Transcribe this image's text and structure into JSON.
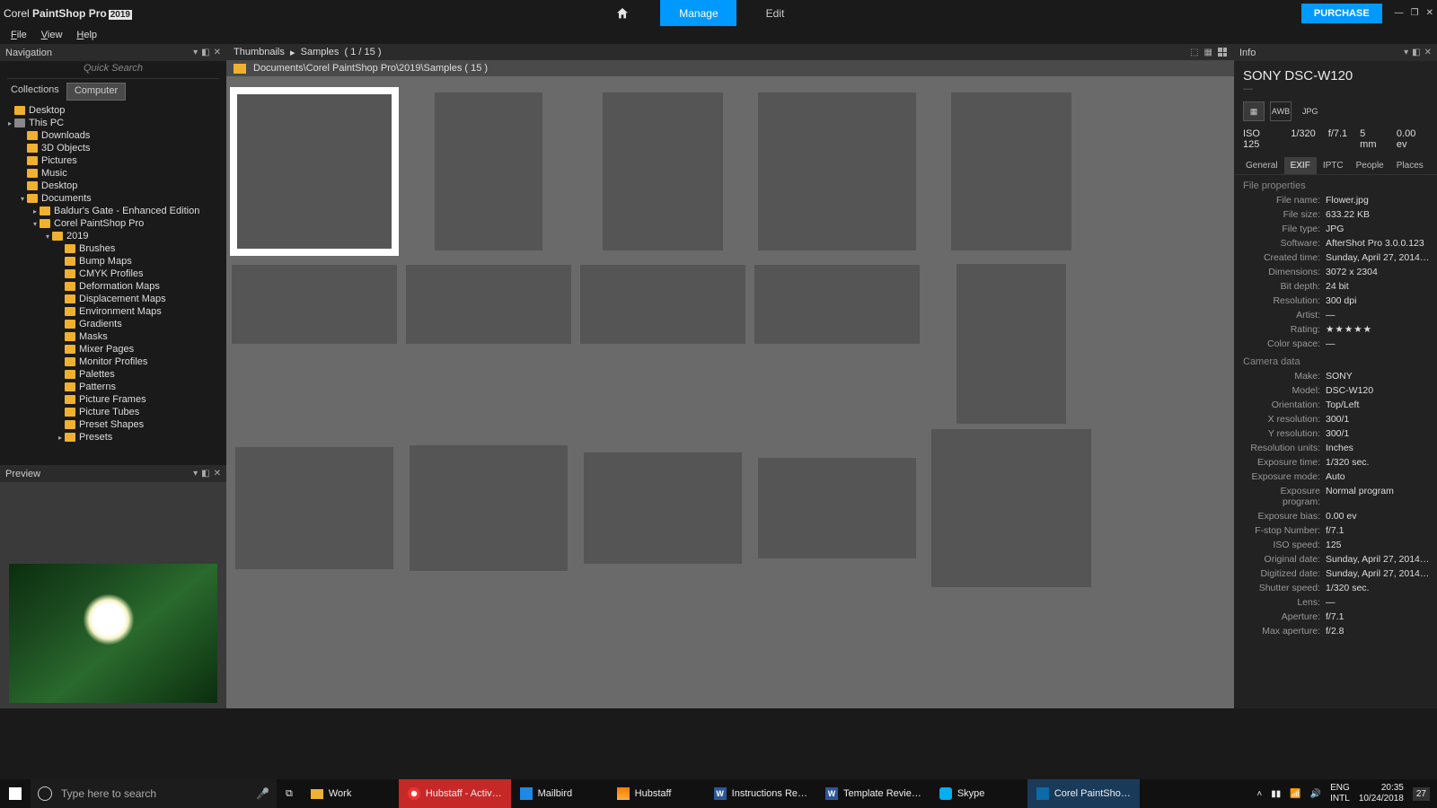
{
  "app": {
    "brand": "Corel",
    "name": "PaintShop Pro",
    "version": "2019"
  },
  "topNav": {
    "home": "Home",
    "manage": "Manage",
    "edit": "Edit",
    "purchase": "PURCHASE"
  },
  "menus": [
    "File",
    "View",
    "Help"
  ],
  "nav": {
    "title": "Navigation",
    "searchPlaceholder": "Quick Search",
    "tabs": {
      "collections": "Collections",
      "computer": "Computer"
    },
    "tree": [
      {
        "lvl": 0,
        "caret": "",
        "icon": "fold",
        "label": "Desktop"
      },
      {
        "lvl": 0,
        "caret": "▸",
        "icon": "drv",
        "label": "This PC"
      },
      {
        "lvl": 1,
        "caret": "",
        "icon": "fold",
        "label": "Downloads"
      },
      {
        "lvl": 1,
        "caret": "",
        "icon": "fold",
        "label": "3D Objects"
      },
      {
        "lvl": 1,
        "caret": "",
        "icon": "fold",
        "label": "Pictures"
      },
      {
        "lvl": 1,
        "caret": "",
        "icon": "fold",
        "label": "Music"
      },
      {
        "lvl": 1,
        "caret": "",
        "icon": "fold",
        "label": "Desktop"
      },
      {
        "lvl": 1,
        "caret": "▾",
        "icon": "fold",
        "label": "Documents"
      },
      {
        "lvl": 2,
        "caret": "▸",
        "icon": "fold",
        "label": "Baldur's Gate - Enhanced Edition"
      },
      {
        "lvl": 2,
        "caret": "▾",
        "icon": "fold",
        "label": "Corel PaintShop Pro"
      },
      {
        "lvl": 3,
        "caret": "▾",
        "icon": "fold",
        "label": "2019"
      },
      {
        "lvl": 4,
        "caret": "",
        "icon": "fold",
        "label": "Brushes"
      },
      {
        "lvl": 4,
        "caret": "",
        "icon": "fold",
        "label": "Bump Maps"
      },
      {
        "lvl": 4,
        "caret": "",
        "icon": "fold",
        "label": "CMYK Profiles"
      },
      {
        "lvl": 4,
        "caret": "",
        "icon": "fold",
        "label": "Deformation Maps"
      },
      {
        "lvl": 4,
        "caret": "",
        "icon": "fold",
        "label": "Displacement Maps"
      },
      {
        "lvl": 4,
        "caret": "",
        "icon": "fold",
        "label": "Environment Maps"
      },
      {
        "lvl": 4,
        "caret": "",
        "icon": "fold",
        "label": "Gradients"
      },
      {
        "lvl": 4,
        "caret": "",
        "icon": "fold",
        "label": "Masks"
      },
      {
        "lvl": 4,
        "caret": "",
        "icon": "fold",
        "label": "Mixer Pages"
      },
      {
        "lvl": 4,
        "caret": "",
        "icon": "fold",
        "label": "Monitor Profiles"
      },
      {
        "lvl": 4,
        "caret": "",
        "icon": "fold",
        "label": "Palettes"
      },
      {
        "lvl": 4,
        "caret": "",
        "icon": "fold",
        "label": "Patterns"
      },
      {
        "lvl": 4,
        "caret": "",
        "icon": "fold",
        "label": "Picture Frames"
      },
      {
        "lvl": 4,
        "caret": "",
        "icon": "fold",
        "label": "Picture Tubes"
      },
      {
        "lvl": 4,
        "caret": "",
        "icon": "fold",
        "label": "Preset Shapes"
      },
      {
        "lvl": 4,
        "caret": "▸",
        "icon": "fold",
        "label": "Presets"
      }
    ]
  },
  "preview": {
    "title": "Preview"
  },
  "crumbs": {
    "a": "Thumbnails",
    "b": "Samples",
    "c": "( 1 / 15 )"
  },
  "path": "Documents\\Corel PaintShop Pro\\2019\\Samples ( 15 )",
  "info": {
    "title": "Info",
    "camera": "SONY DSC-W120",
    "jpgBadge": "JPG",
    "exif": {
      "iso": "ISO 125",
      "shutter": "1/320",
      "f": "f/7.1",
      "focal": "5 mm",
      "ev": "0.00 ev"
    },
    "tabs": [
      "General",
      "EXIF",
      "IPTC",
      "People",
      "Places"
    ],
    "fileSection": "File properties",
    "file": [
      {
        "k": "File name:",
        "v": "Flower.jpg"
      },
      {
        "k": "File size:",
        "v": "633.22 KB"
      },
      {
        "k": "File type:",
        "v": "JPG"
      },
      {
        "k": "Software:",
        "v": "AfterShot Pro 3.0.0.123"
      },
      {
        "k": "Created time:",
        "v": "Sunday, April 27, 2014…"
      },
      {
        "k": "Dimensions:",
        "v": "3072 x 2304"
      },
      {
        "k": "Bit depth:",
        "v": "24 bit"
      },
      {
        "k": "Resolution:",
        "v": "300 dpi"
      },
      {
        "k": "Artist:",
        "v": "—"
      },
      {
        "k": "Rating:",
        "v": "★★★★★"
      },
      {
        "k": "Color space:",
        "v": "—"
      }
    ],
    "camSection": "Camera data",
    "cam": [
      {
        "k": "Make:",
        "v": "SONY"
      },
      {
        "k": "Model:",
        "v": "DSC-W120"
      },
      {
        "k": "Orientation:",
        "v": "Top/Left"
      },
      {
        "k": "X resolution:",
        "v": "300/1"
      },
      {
        "k": "Y resolution:",
        "v": "300/1"
      },
      {
        "k": "Resolution units:",
        "v": "Inches"
      },
      {
        "k": "Exposure time:",
        "v": "1/320 sec."
      },
      {
        "k": "Exposure mode:",
        "v": "Auto"
      },
      {
        "k": "Exposure program:",
        "v": "Normal program"
      },
      {
        "k": "Exposure bias:",
        "v": "0.00 ev"
      },
      {
        "k": "F-stop Number:",
        "v": "f/7.1"
      },
      {
        "k": "ISO speed:",
        "v": "125"
      },
      {
        "k": "Original date:",
        "v": "Sunday, April 27, 2014…"
      },
      {
        "k": "Digitized date:",
        "v": "Sunday, April 27, 2014…"
      },
      {
        "k": "Shutter speed:",
        "v": "1/320 sec."
      },
      {
        "k": "Lens:",
        "v": "—"
      },
      {
        "k": "Aperture:",
        "v": "f/7.1"
      },
      {
        "k": "Max aperture:",
        "v": "f/2.8"
      }
    ]
  },
  "taskbar": {
    "searchPlaceholder": "Type here to search",
    "items": [
      {
        "cls": "",
        "ico": "fold2",
        "label": "Work"
      },
      {
        "cls": "red",
        "ico": "opera",
        "label": "Hubstaff - Activ…"
      },
      {
        "cls": "",
        "ico": "mb",
        "label": "Mailbird"
      },
      {
        "cls": "",
        "ico": "hs",
        "label": "Hubstaff"
      },
      {
        "cls": "",
        "ico": "word",
        "label": "Instructions Re…"
      },
      {
        "cls": "",
        "ico": "word",
        "label": "Template Revie…"
      },
      {
        "cls": "",
        "ico": "sk",
        "label": "Skype"
      },
      {
        "cls": "blue",
        "ico": "psp",
        "label": "Corel PaintSho…"
      }
    ],
    "lang1": "ENG",
    "lang2": "INTL",
    "time": "20:35",
    "date": "10/24/2018",
    "notif": "27"
  }
}
